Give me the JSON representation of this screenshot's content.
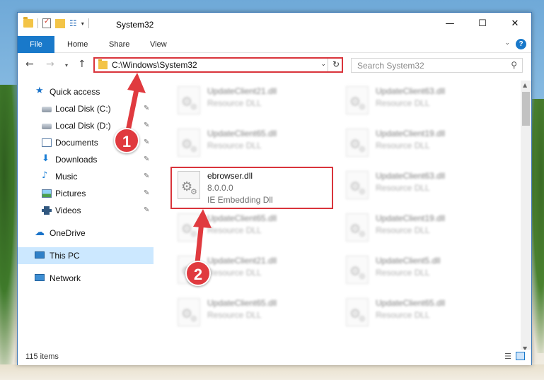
{
  "window": {
    "title": "System32",
    "controls": {
      "minimize": "—",
      "maximize": "☐",
      "close": "✕"
    }
  },
  "ribbon": {
    "tabs": [
      "File",
      "Home",
      "Share",
      "View"
    ],
    "help": "?"
  },
  "address": {
    "path": "C:\\Windows\\System32",
    "search_placeholder": "Search System32"
  },
  "nav_pane": {
    "items": [
      {
        "label": "Quick access",
        "icon": "star-icon",
        "pinned": false
      },
      {
        "label": "Local Disk (C:)",
        "icon": "disk-icon",
        "pinned": true
      },
      {
        "label": "Local Disk (D:)",
        "icon": "disk-icon",
        "pinned": true
      },
      {
        "label": "Documents",
        "icon": "documents-icon",
        "pinned": true
      },
      {
        "label": "Downloads",
        "icon": "download-icon",
        "pinned": true
      },
      {
        "label": "Music",
        "icon": "music-icon",
        "pinned": true
      },
      {
        "label": "Pictures",
        "icon": "pictures-icon",
        "pinned": true
      },
      {
        "label": "Videos",
        "icon": "videos-icon",
        "pinned": true
      },
      {
        "label": "OneDrive",
        "icon": "cloud-icon",
        "pinned": false
      },
      {
        "label": "This PC",
        "icon": "pc-icon",
        "pinned": false,
        "selected": true
      },
      {
        "label": "Network",
        "icon": "network-icon",
        "pinned": false
      }
    ]
  },
  "files": {
    "left_column": [
      {
        "name": "UpdateClient21.dll",
        "type": "Resource DLL",
        "blurred": true
      },
      {
        "name": "UpdateClient65.dll",
        "type": "Resource DLL",
        "blurred": true
      },
      {
        "name": "ebrowser.dll",
        "version": "8.0.0.0",
        "type": "IE Embedding Dll",
        "blurred": false,
        "highlighted": true
      },
      {
        "name": "UpdateClient65.dll",
        "type": "Resource DLL",
        "blurred": true
      },
      {
        "name": "UpdateClient21.dll",
        "type": "Resource DLL",
        "blurred": true
      },
      {
        "name": "UpdateClient65.dll",
        "type": "Resource DLL",
        "blurred": true
      }
    ],
    "right_column": [
      {
        "name": "UpdateClient63.dll",
        "type": "Resource DLL",
        "blurred": true
      },
      {
        "name": "UpdateClient19.dll",
        "type": "Resource DLL",
        "blurred": true
      },
      {
        "name": "UpdateClient63.dll",
        "type": "Resource DLL",
        "blurred": true
      },
      {
        "name": "UpdateClient19.dll",
        "type": "Resource DLL",
        "blurred": true
      },
      {
        "name": "UpdateClient5.dll",
        "type": "Resource DLL",
        "blurred": true
      },
      {
        "name": "UpdateClient65.dll",
        "type": "Resource DLL",
        "blurred": true
      }
    ]
  },
  "status": {
    "item_count": "115 items"
  },
  "callouts": {
    "step1": "1",
    "step2": "2",
    "color": "#e03a3f"
  }
}
